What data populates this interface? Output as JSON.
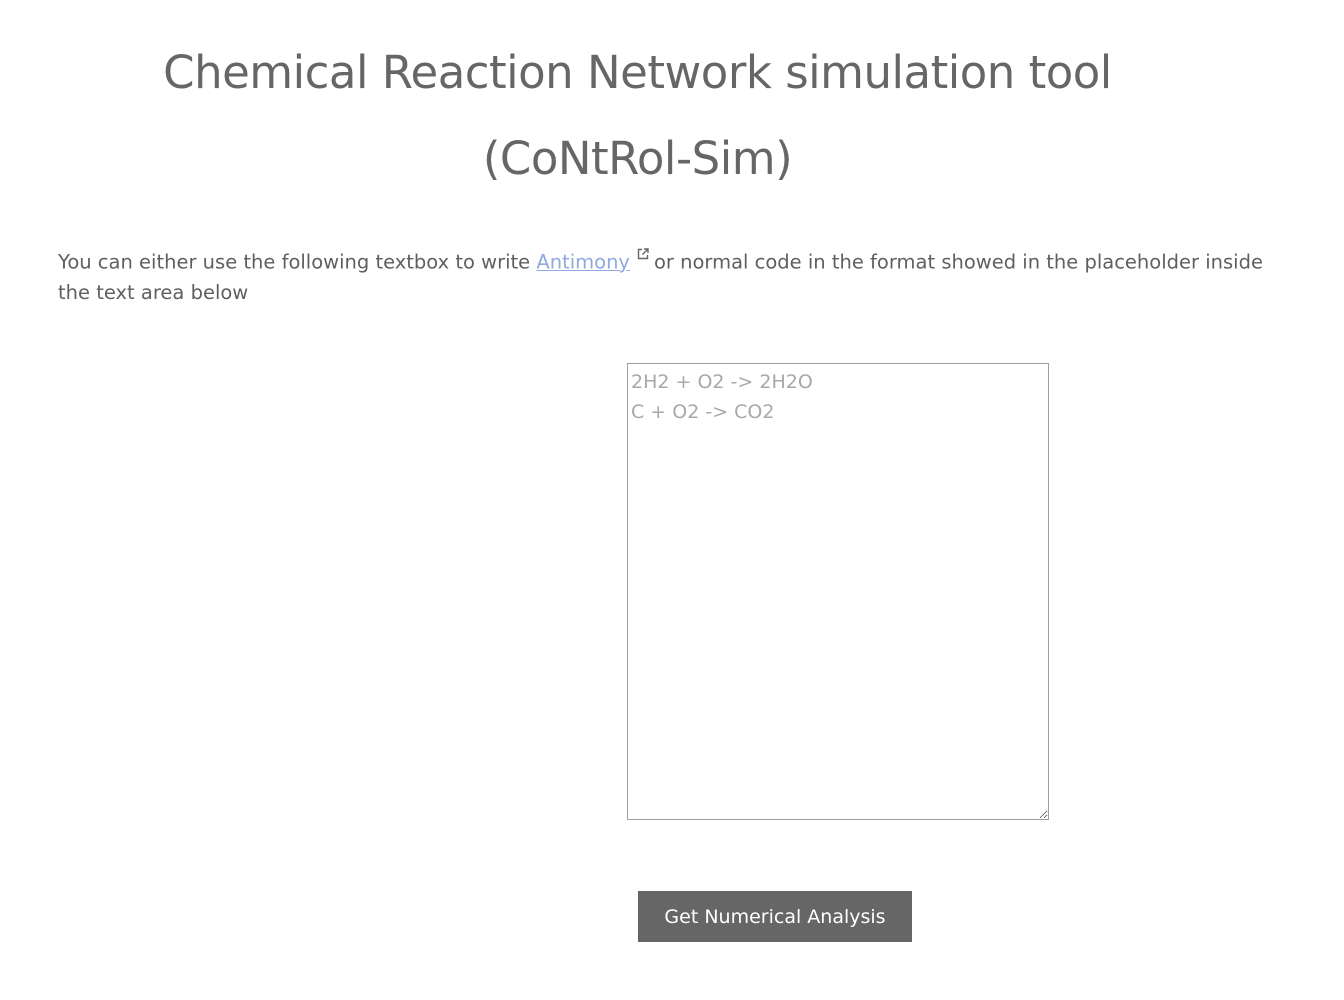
{
  "header": {
    "title_line1": "Chemical Reaction Network simulation tool",
    "title_line2": "(CoNtRol-Sim)"
  },
  "intro": {
    "text_before": "You can either use the following textbox to write ",
    "link_label": "Antimony",
    "link_icon": "external-link-icon",
    "text_after": "or normal code in the format showed in the placeholder inside the text area below"
  },
  "editor": {
    "value": "",
    "placeholder": "2H2 + O2 -> 2H2O\nC + O2 -> CO2"
  },
  "actions": {
    "analysis_label": "Get Numerical Analysis"
  },
  "colors": {
    "title": "#666666",
    "text": "#5f5f5f",
    "link": "#8fa8dd",
    "placeholder": "#a8a8a8",
    "button_bg": "#666666",
    "button_text": "#ffffff"
  }
}
